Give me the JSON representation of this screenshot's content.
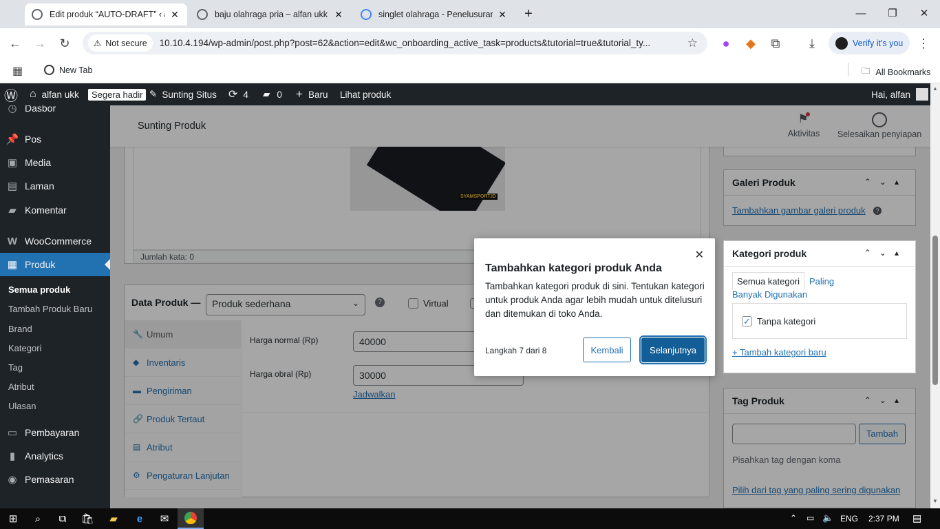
{
  "browser": {
    "tabs": [
      {
        "title": "Edit produk “AUTO-DRAFT” ‹ alf"
      },
      {
        "title": "baju olahraga pria – alfan ukk"
      },
      {
        "title": "singlet olahraga - Penelusuran G"
      }
    ],
    "new_tab_symbol": "+",
    "security_label": "Not secure",
    "url": "10.10.4.194/wp-admin/post.php?post=62&action=edit&wc_onboarding_active_task=products&tutorial=true&tutorial_ty...",
    "verify_label": "Verify it's you",
    "bookmark_newtab": "New Tab",
    "all_bookmarks": "All Bookmarks"
  },
  "adminbar": {
    "site_name": "alfan ukk",
    "badge": "Segera hadir",
    "edit_site": "Sunting Situs",
    "updates_count": "4",
    "comments_count": "0",
    "new_label": "Baru",
    "view_product": "Lihat produk",
    "greeting": "Hai, alfan"
  },
  "sidebar": {
    "items": [
      {
        "label": "Dasbor",
        "icon": "dashboard-icon"
      },
      {
        "label": "Pos",
        "icon": "pin-icon"
      },
      {
        "label": "Media",
        "icon": "media-icon"
      },
      {
        "label": "Laman",
        "icon": "page-icon"
      },
      {
        "label": "Komentar",
        "icon": "comment-icon"
      },
      {
        "label": "WooCommerce",
        "icon": "woo-icon"
      },
      {
        "label": "Produk",
        "icon": "archive-icon"
      },
      {
        "label": "Pembayaran",
        "icon": "payment-icon"
      },
      {
        "label": "Analytics",
        "icon": "chart-icon"
      },
      {
        "label": "Pemasaran",
        "icon": "megaphone-icon"
      }
    ],
    "submenu": [
      "Semua produk",
      "Tambah Produk Baru",
      "Brand",
      "Kategori",
      "Tag",
      "Atribut",
      "Ulasan"
    ]
  },
  "header": {
    "title": "Sunting Produk",
    "activity": "Aktivitas",
    "finish_setup": "Selesaikan penyiapan"
  },
  "editor": {
    "word_count": "Jumlah kata: 0",
    "image_watermark": "SYAMSPORT.ID"
  },
  "product_data": {
    "title": "Data Produk —",
    "type_selected": "Produk sederhana",
    "virtual_label": "Virtual",
    "tabs": [
      "Umum",
      "Inventaris",
      "Pengiriman",
      "Produk Tertaut",
      "Atribut",
      "Pengaturan Lanjutan"
    ],
    "regular_price_label": "Harga normal (Rp)",
    "regular_price_value": "40000",
    "sale_price_label": "Harga obral (Rp)",
    "sale_price_value": "30000",
    "schedule_link": "Jadwalkan"
  },
  "gallery": {
    "title": "Galeri Produk",
    "add_link": "Tambahkan gambar galeri produk"
  },
  "categories": {
    "title": "Kategori produk",
    "tab_all": "Semua kategori",
    "tab_popular_1": "Paling",
    "tab_popular_2": "Banyak Digunakan",
    "item": "Tanpa kategori",
    "add_new": "+ Tambah kategori baru"
  },
  "tags": {
    "title": "Tag Produk",
    "add_button": "Tambah",
    "hint": "Pisahkan tag dengan koma",
    "choose_link": "Pilih dari tag yang paling sering digunakan"
  },
  "modal": {
    "title": "Tambahkan kategori produk Anda",
    "body": "Tambahkan kategori produk di sini. Tentukan kategori untuk produk Anda agar lebih mudah untuk ditelusuri dan ditemukan di toko Anda.",
    "step": "Langkah 7 dari 8",
    "back": "Kembali",
    "next": "Selanjutnya"
  },
  "taskbar": {
    "language": "ENG",
    "time": "2:37 PM"
  },
  "colors": {
    "wp_dark": "#1d2327",
    "wp_blue": "#2271b1",
    "modal_primary": "#135e96"
  }
}
